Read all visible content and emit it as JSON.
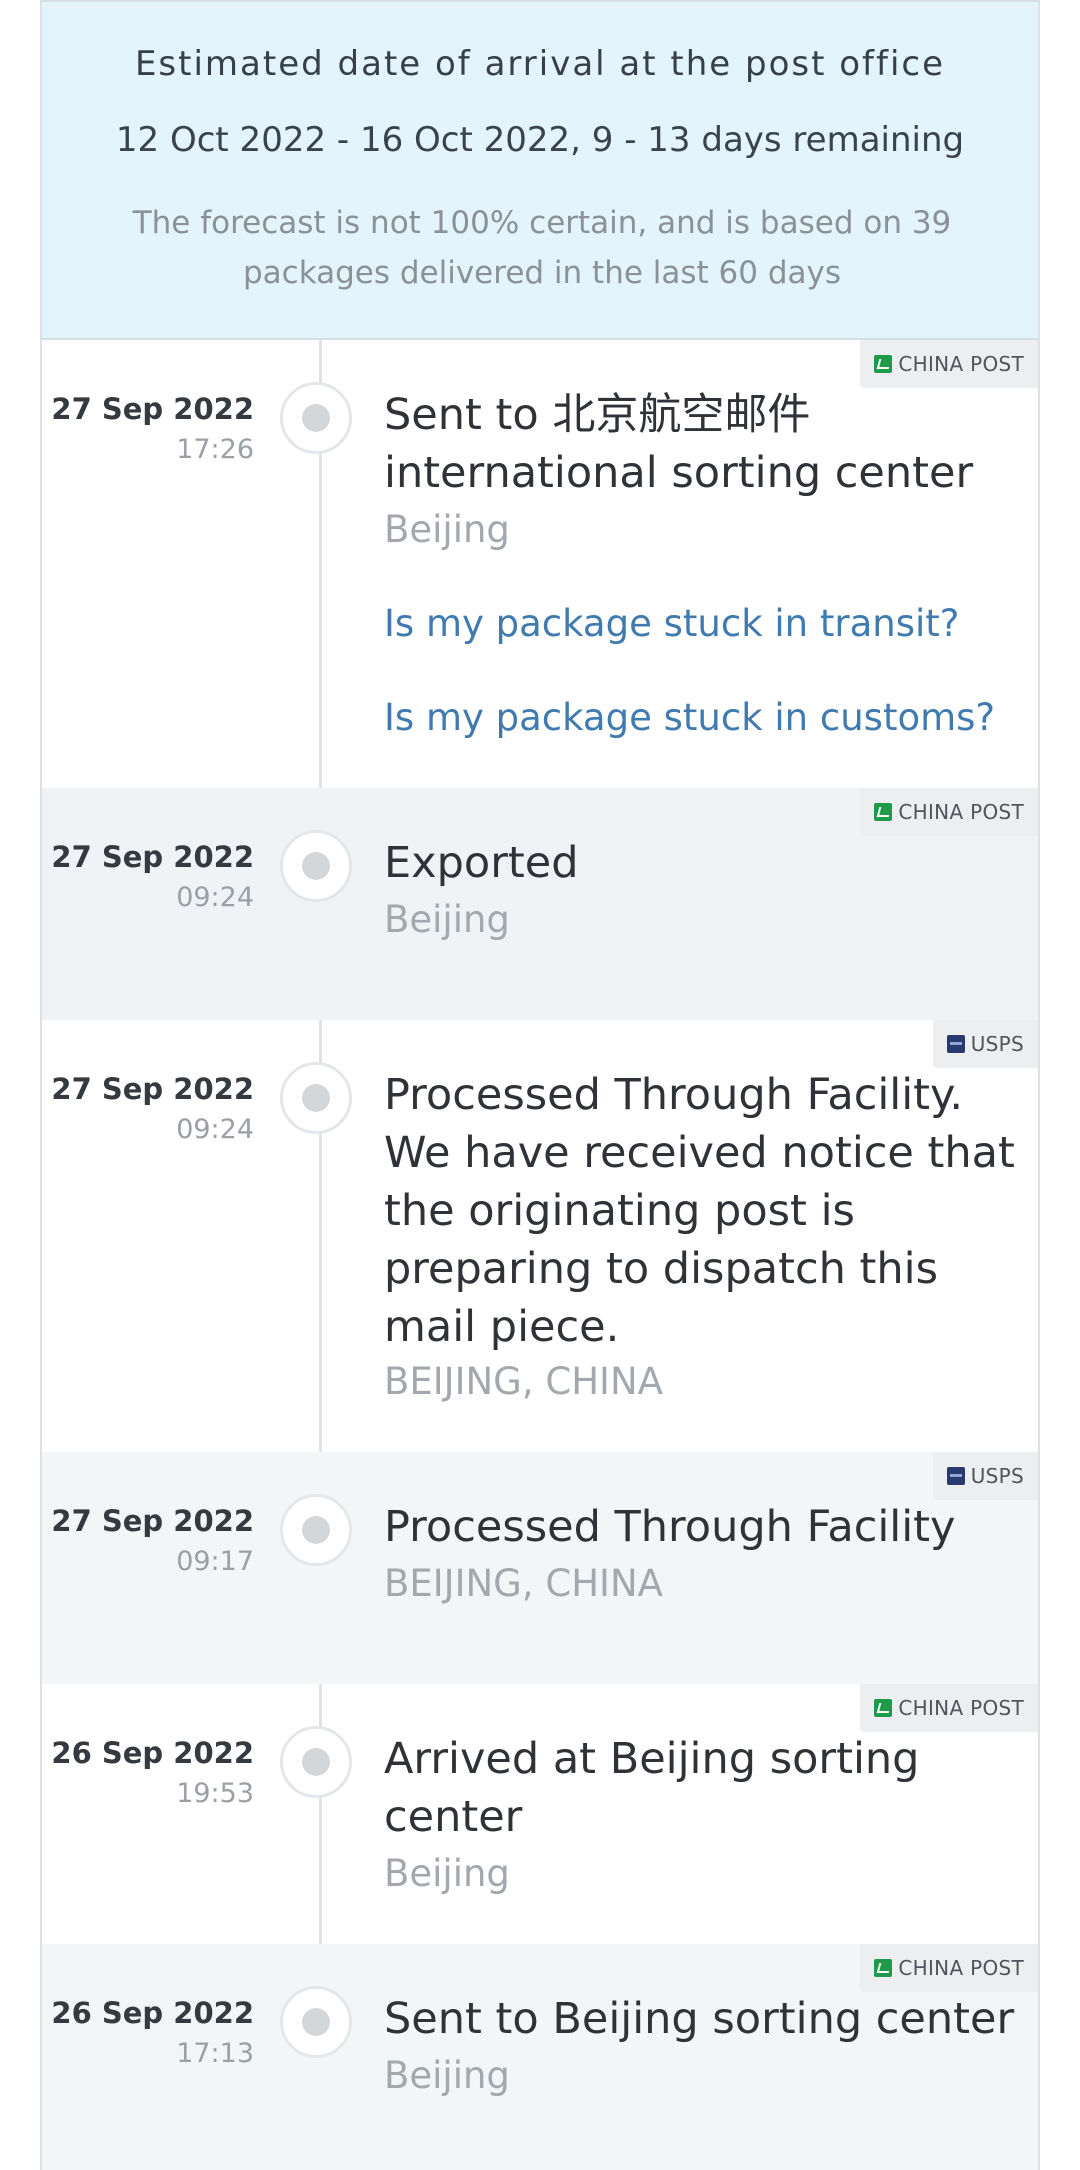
{
  "estimate": {
    "title": "Estimated date of arrival at the post office",
    "range": "12 Oct 2022 - 16 Oct 2022, 9 - 13 days remaining",
    "note": "The forecast is not 100% certain, and is based on 39 packages delivered in the last 60 days"
  },
  "colors": {
    "link": "#3f7bb0",
    "china_post_green": "#1f9a4a",
    "usps_navy": "#2a3a6e",
    "estimate_bg": "#e4f4fd"
  },
  "events": [
    {
      "carrier": "CHINA POST",
      "carrier_icon": "china-post-icon",
      "date": "27 Sep 2022",
      "time": "17:26",
      "description": "Sent to 北京航空邮件 international sorting center",
      "location": "Beijing",
      "links": [
        "Is my package stuck in transit?",
        "Is my package stuck in customs?"
      ]
    },
    {
      "carrier": "CHINA POST",
      "carrier_icon": "china-post-icon",
      "date": "27 Sep 2022",
      "time": "09:24",
      "description": "Exported",
      "location": "Beijing"
    },
    {
      "carrier": "USPS",
      "carrier_icon": "usps-icon",
      "date": "27 Sep 2022",
      "time": "09:24",
      "description": "Processed Through Facility. We have received notice that the originating post is preparing to dispatch this mail piece.",
      "location": "BEIJING, CHINA"
    },
    {
      "carrier": "USPS",
      "carrier_icon": "usps-icon",
      "date": "27 Sep 2022",
      "time": "09:17",
      "description": "Processed Through Facility",
      "location": "BEIJING, CHINA"
    },
    {
      "carrier": "CHINA POST",
      "carrier_icon": "china-post-icon",
      "date": "26 Sep 2022",
      "time": "19:53",
      "description": "Arrived at Beijing sorting center",
      "location": "Beijing"
    },
    {
      "carrier": "CHINA POST",
      "carrier_icon": "china-post-icon",
      "date": "26 Sep 2022",
      "time": "17:13",
      "description": "Sent to Beijing sorting center",
      "location": "Beijing"
    }
  ]
}
